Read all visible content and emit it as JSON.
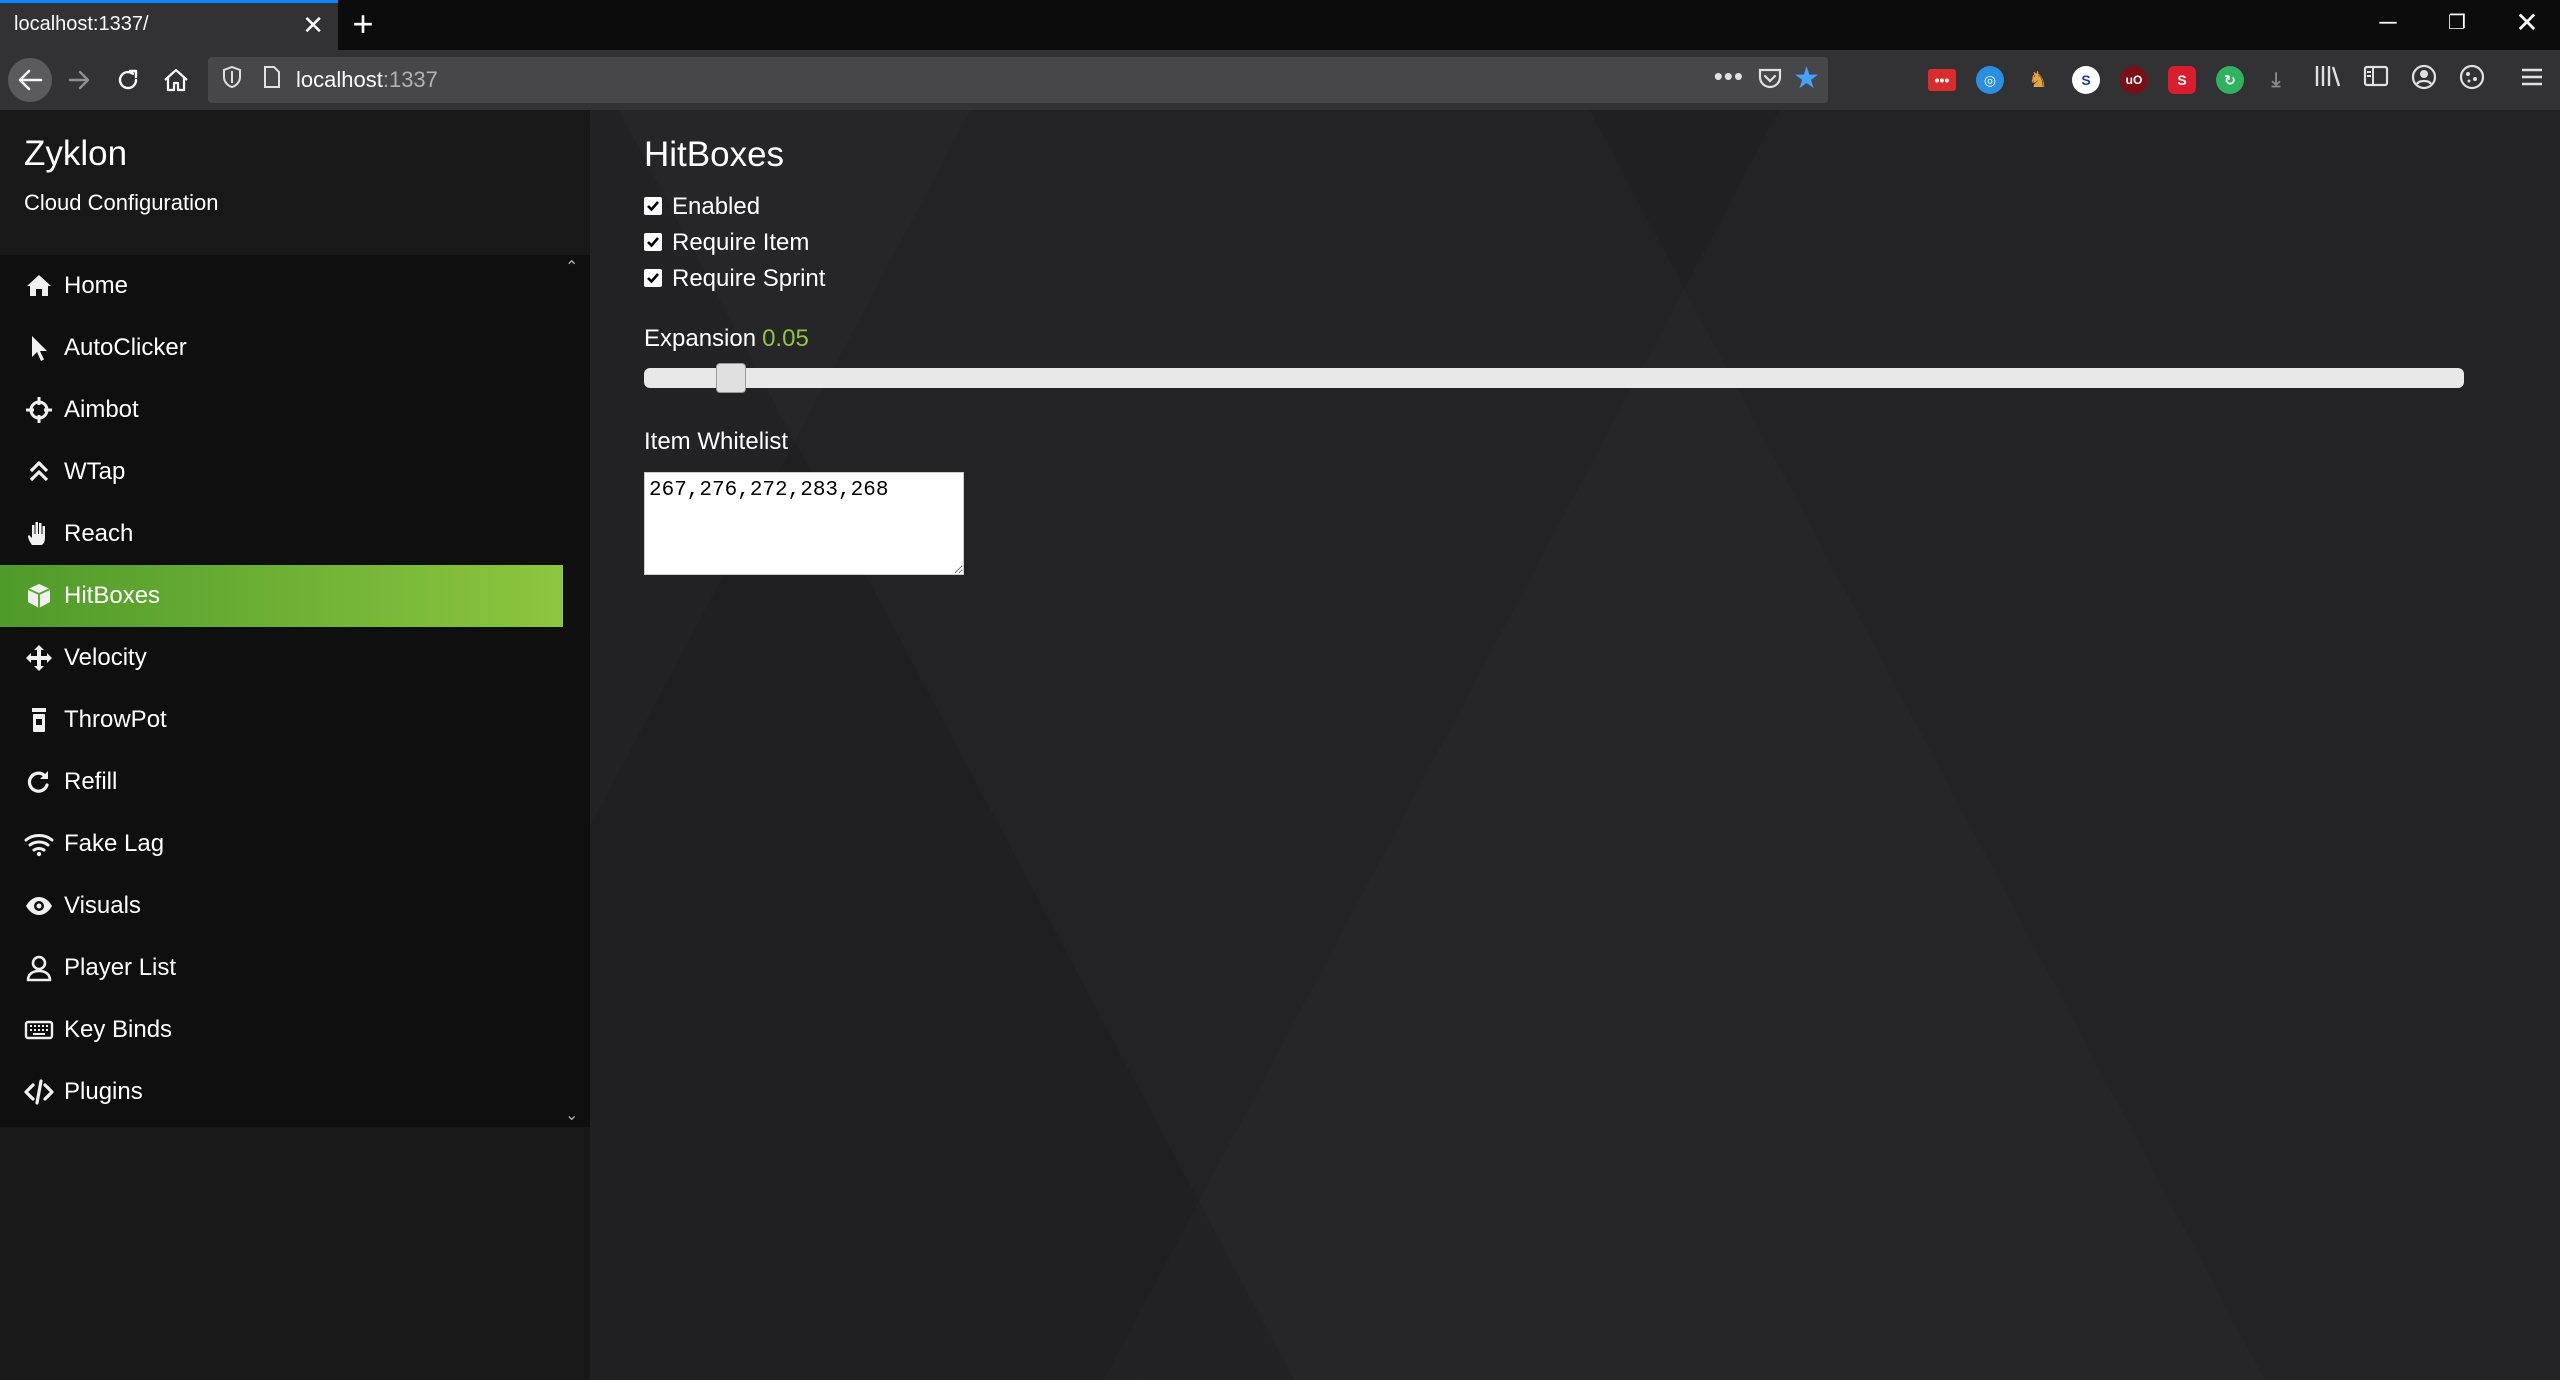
{
  "browser": {
    "tab_title": "localhost:1337/",
    "tab_close": "✕",
    "new_tab": "+",
    "url_host": "localhost",
    "url_port": ":1337",
    "window_controls": {
      "minimize": "─",
      "restore": "❐",
      "close": "✕"
    },
    "extensions": [
      "•••",
      "",
      "",
      "S",
      "uO",
      "S",
      "",
      ""
    ]
  },
  "sidebar": {
    "title": "Zyklon",
    "subtitle": "Cloud Configuration",
    "items": [
      {
        "label": "Home",
        "icon": "home-icon"
      },
      {
        "label": "AutoClicker",
        "icon": "mouse-pointer-icon"
      },
      {
        "label": "Aimbot",
        "icon": "crosshairs-icon"
      },
      {
        "label": "WTap",
        "icon": "double-chevron-up-icon"
      },
      {
        "label": "Reach",
        "icon": "hand-icon"
      },
      {
        "label": "HitBoxes",
        "icon": "cube-icon",
        "active": true
      },
      {
        "label": "Velocity",
        "icon": "arrows-move-icon"
      },
      {
        "label": "ThrowPot",
        "icon": "potion-icon"
      },
      {
        "label": "Refill",
        "icon": "redo-icon"
      },
      {
        "label": "Fake Lag",
        "icon": "wifi-icon"
      },
      {
        "label": "Visuals",
        "icon": "eye-icon"
      },
      {
        "label": "Player List",
        "icon": "user-icon"
      },
      {
        "label": "Key Binds",
        "icon": "keyboard-icon"
      },
      {
        "label": "Plugins",
        "icon": "code-icon"
      }
    ]
  },
  "main": {
    "title": "HitBoxes",
    "checkboxes": [
      {
        "label": "Enabled",
        "checked": true
      },
      {
        "label": "Require Item",
        "checked": true
      },
      {
        "label": "Require Sprint",
        "checked": true
      }
    ],
    "expansion": {
      "label": "Expansion",
      "value": "0.05",
      "slider_fraction": 0.04
    },
    "whitelist": {
      "label": "Item Whitelist",
      "value": "267,276,272,283,268"
    }
  },
  "colors": {
    "accent": "#8dc63f",
    "accent_dark": "#4e9a2a",
    "tab_highlight": "#0a84ff"
  }
}
